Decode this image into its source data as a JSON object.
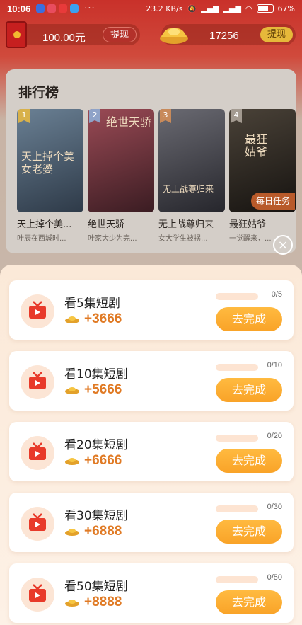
{
  "status_bar": {
    "time": "10:06",
    "more": "···",
    "network": "23.2 KB/s",
    "battery": "67%",
    "app_colors": [
      "#3b6fe0",
      "#e84c5e",
      "#e83a3a",
      "#3aa0f0"
    ]
  },
  "wallet": {
    "cash_amount": "100.00元",
    "cash_withdraw_label": "提现",
    "coin_amount": "17256",
    "coin_withdraw_label": "提现"
  },
  "ranking": {
    "title": "排行榜",
    "items": [
      {
        "rank": "1",
        "name": "天上掉个美...",
        "desc": "叶辰在西城时...",
        "poster_text": "天上掉个美女老婆",
        "poster_color": "#3a4a5e",
        "badge_color": "#d8b14a"
      },
      {
        "rank": "2",
        "name": "绝世天骄",
        "desc": "叶家大少为完...",
        "poster_text": "绝世天骄",
        "poster_color": "#5a2a30",
        "badge_color": "#8fa3c8"
      },
      {
        "rank": "3",
        "name": "无上战尊归来",
        "desc": "女大学生被拐...",
        "poster_text": "无上战尊归来",
        "poster_color": "#3a3a40",
        "badge_color": "#c88a5a"
      },
      {
        "rank": "4",
        "name": "最狂姑爷",
        "desc": "一觉醒来，...",
        "poster_text": "最狂姑爷",
        "poster_color": "#2a2520",
        "badge_color": "#a39a90"
      }
    ],
    "daily_tag": "每日任务"
  },
  "close_label": "×",
  "tasks": [
    {
      "title": "看5集短剧",
      "reward": "+3666",
      "progress": "0/5",
      "button": "去完成"
    },
    {
      "title": "看10集短剧",
      "reward": "+5666",
      "progress": "0/10",
      "button": "去完成"
    },
    {
      "title": "看20集短剧",
      "reward": "+6666",
      "progress": "0/20",
      "button": "去完成"
    },
    {
      "title": "看30集短剧",
      "reward": "+6888",
      "progress": "0/30",
      "button": "去完成"
    },
    {
      "title": "看50集短剧",
      "reward": "+8888",
      "progress": "0/50",
      "button": "去完成"
    }
  ],
  "accent_colors": {
    "orange": "#f9a328",
    "reward": "#e07a24",
    "red": "#c9312a"
  }
}
